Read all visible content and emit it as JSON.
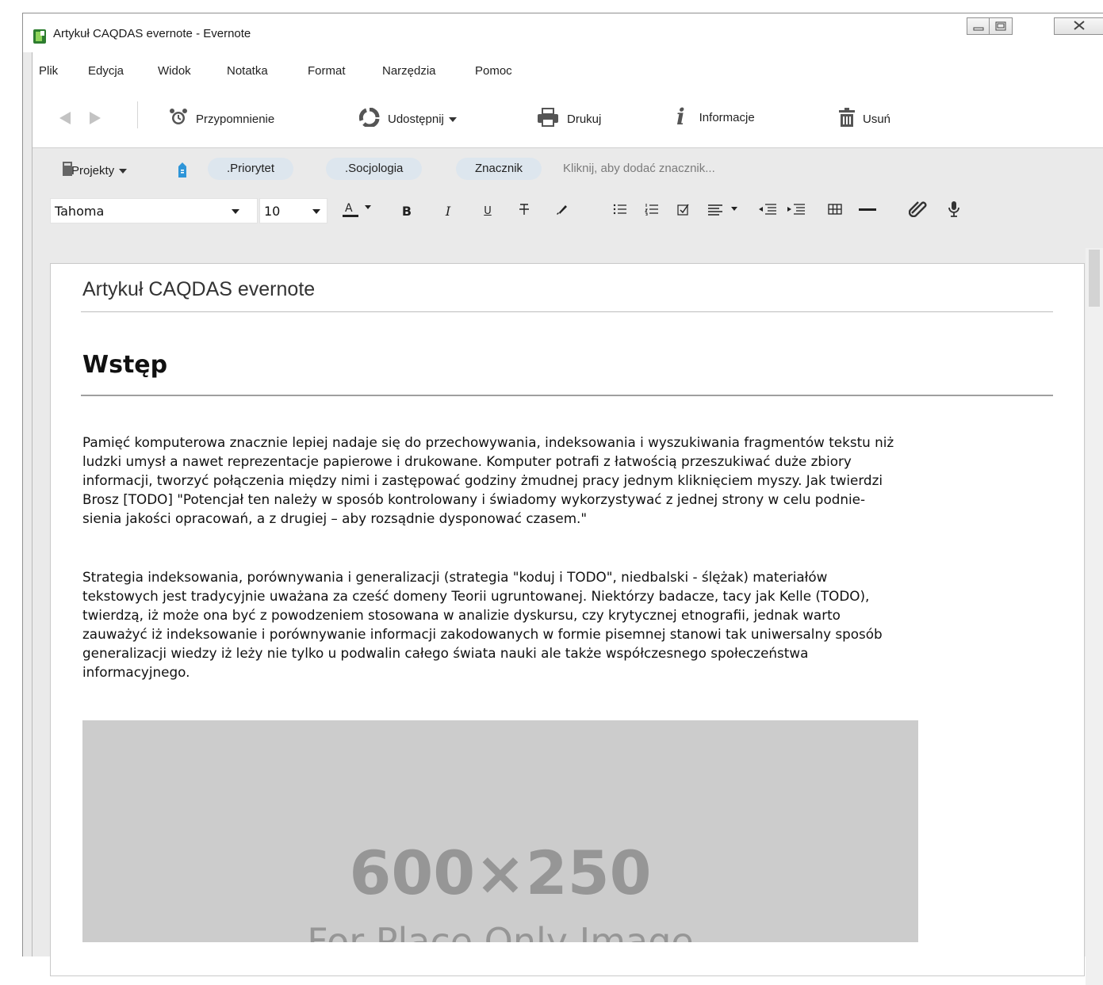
{
  "window": {
    "title": "Artykuł CAQDAS evernote - Evernote"
  },
  "menu": [
    "Plik",
    "Edycja",
    "Widok",
    "Notatka",
    "Format",
    "Narzędzia",
    "Pomoc"
  ],
  "toolbar": {
    "reminder_label": "Przypomnienie",
    "share_label": "Udostępnij",
    "print_label": "Drukuj",
    "info_label": "Informacje",
    "delete_label": "Usuń"
  },
  "tags": {
    "notebook_label": "Projekty",
    "items": [
      ".Priorytet",
      ".Socjologia",
      "Znacznik"
    ],
    "add_hint": "Kliknij, aby dodać znacznik..."
  },
  "format": {
    "font": "Tahoma",
    "size": "10"
  },
  "note": {
    "title": "Artykuł CAQDAS evernote",
    "heading": "Wstęp",
    "paragraph1": [
      "Pamięć komputerowa znacznie lepiej nadaje się do przechowywania, indeksowania i wyszukiwania fragmentów tekstu niż",
      "ludzki umysł a nawet reprezentacje papierowe i drukowane. Komputer potrafi z łatwością przeszukiwać duże zbiory",
      "informacji, tworzyć połączenia między nimi i zastępować godziny żmudnej pracy jednym kliknięciem myszy. Jak twierdzi",
      "Brosz [TODO] \"Potencjał ten należy w sposób kontrolowany i świadomy wykorzystywać z jednej strony w celu podnie-",
      "sienia jakości opracowań, a z drugiej – aby rozsądnie dysponować czasem.\""
    ],
    "paragraph2": [
      "Strategia indeksowania, porównywania i generalizacji (strategia \"koduj i TODO\", niedbalski - ślężak) materiałów",
      "tekstowych jest tradycyjnie uważana za cześć domeny Teorii ugruntowanej. Niektórzy badacze, tacy jak Kelle (TODO),",
      "twierdzą, iż może ona być z powodzeniem stosowana w analizie dyskursu, czy krytycznej etnografii, jednak warto",
      "zauważyć iż indeksowanie i porównywanie informacji zakodowanych w formie pisemnej stanowi tak uniwersalny sposób",
      "generalizacji wiedzy iż leży nie tylko u podwalin całego świata nauki ale także współczesnego społeczeństwa",
      "informacyjnego."
    ],
    "image": {
      "size_text": "600×250",
      "caption": "For Place Only Image"
    }
  }
}
